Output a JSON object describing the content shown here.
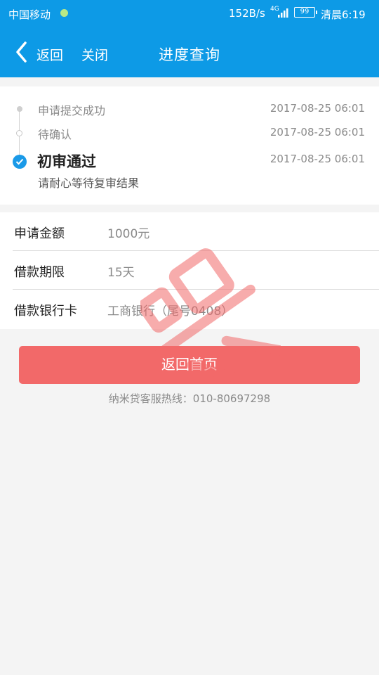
{
  "status_bar": {
    "carrier": "中国移动",
    "speed": "152B/s",
    "network": "4G",
    "battery": "99",
    "time": "清晨6:19"
  },
  "nav": {
    "back": "返回",
    "close": "关闭",
    "title": "进度查询"
  },
  "timeline": {
    "steps": [
      {
        "title": "申请提交成功",
        "date": "2017-08-25 06:01"
      },
      {
        "title": "待确认",
        "date": "2017-08-25 06:01"
      },
      {
        "title": "初审通过",
        "date": "2017-08-25 06:01",
        "note": "请耐心等待复审结果"
      }
    ]
  },
  "details": [
    {
      "label": "申请金额",
      "value": "1000元"
    },
    {
      "label": "借款期限",
      "value": "15天"
    },
    {
      "label": "借款银行卡",
      "value": "工商银行（尾号0408）"
    }
  ],
  "home_button": "返回首页",
  "hotline": "纳米贷客服热线：010-80697298",
  "colors": {
    "header": "#0d9ae6",
    "button": "#f26969",
    "check": "#1a9ae8"
  }
}
